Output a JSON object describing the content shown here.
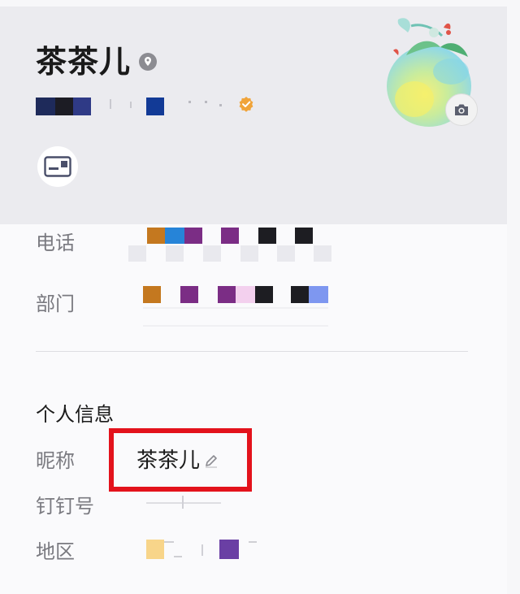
{
  "profile": {
    "name": "茶茶儿",
    "location_icon": "location-pin-icon",
    "verified_icon": "verified-badge-icon",
    "card_icon": "business-card-icon",
    "camera_icon": "camera-icon"
  },
  "info": {
    "phone_label": "电话",
    "department_label": "部门"
  },
  "personal": {
    "section_title": "个人信息",
    "nickname_label": "昵称",
    "nickname_value": "茶茶儿",
    "edit_icon": "edit-pencil-icon",
    "dingtalk_id_label": "钉钉号",
    "region_label": "地区"
  },
  "colors": {
    "highlight_border": "#e3121c",
    "verified": "#f0a43a",
    "header_bg": "#ebebef"
  }
}
